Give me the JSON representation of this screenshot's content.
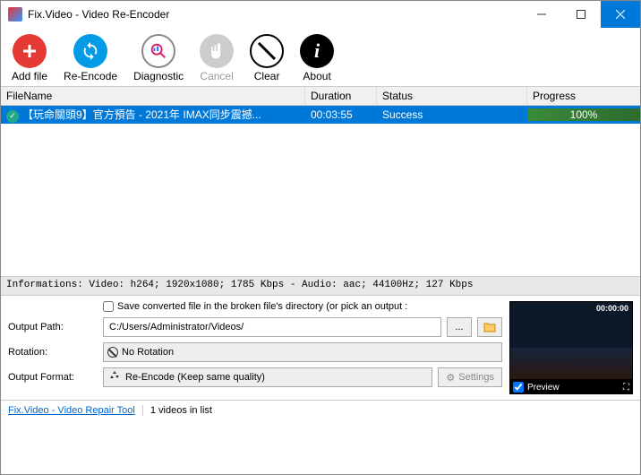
{
  "title": "Fix.Video - Video Re-Encoder",
  "toolbar": {
    "add_file": "Add file",
    "re_encode": "Re-Encode",
    "diagnostic": "Diagnostic",
    "cancel": "Cancel",
    "clear": "Clear",
    "about": "About"
  },
  "columns": {
    "filename": "FileName",
    "duration": "Duration",
    "status": "Status",
    "progress": "Progress"
  },
  "rows": [
    {
      "filename": "【玩命關頭9】官方預告 - 2021年 IMAX同步震撼...",
      "duration": "00:03:55",
      "status": "Success",
      "progress": "100%"
    }
  ],
  "info_bar": "Informations:  Video: h264; 1920x1080; 1785 Kbps - Audio: aac; 44100Hz; 127 Kbps",
  "options": {
    "save_checkbox": "Save converted file in the broken file's directory (or pick an output :",
    "output_path_label": "Output Path:",
    "output_path_value": "C:/Users/Administrator/Videos/",
    "browse_dots": "...",
    "rotation_label": "Rotation:",
    "rotation_value": "No Rotation",
    "format_label": "Output Format:",
    "format_value": "Re-Encode (Keep same quality)",
    "settings_btn": "Settings"
  },
  "preview": {
    "time": "00:00:00",
    "label": "Preview"
  },
  "statusbar": {
    "link": "Fix.Video - Video Repair Tool",
    "count": "1 videos in list"
  }
}
